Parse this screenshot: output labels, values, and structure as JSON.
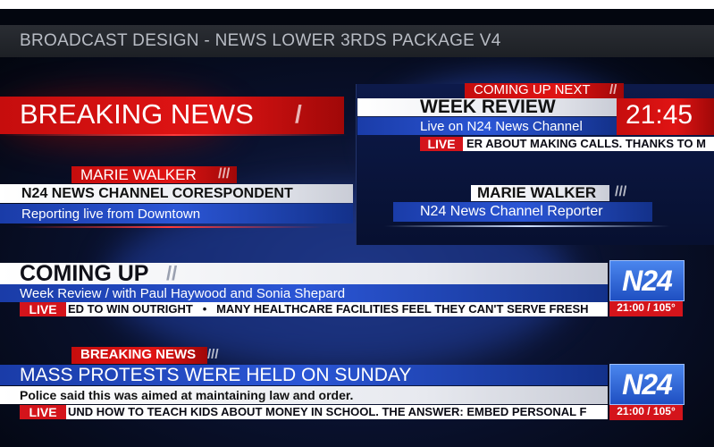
{
  "window_title": "BROADCAST DESIGN - NEWS LOWER 3RDS PACKAGE V4",
  "breaking": {
    "title": "BREAKING NEWS",
    "slash": "/"
  },
  "coming_next": {
    "label": "COMING UP NEXT",
    "slash": "//",
    "title": "WEEK REVIEW",
    "subtitle": "Live on N24 News Channel",
    "time": "21:45",
    "live": "LIVE",
    "ticker": "ER ABOUT MAKING CALLS. THANKS TO M"
  },
  "marie1": {
    "name": "MARIE WALKER",
    "slash": "///",
    "role": "N24 NEWS CHANNEL CORESPONDENT",
    "desc": "Reporting live from Downtown"
  },
  "marie2": {
    "name": "MARIE WALKER",
    "slash": "///",
    "role": "N24 News Channel Reporter"
  },
  "coming_up": {
    "title": "COMING UP",
    "slash": "//",
    "subtitle": "Week Review / with Paul Haywood and Sonia Shepard",
    "live": "LIVE",
    "ticker": "ED TO WIN OUTRIGHT   •   MANY HEALTHCARE FACILITIES FEEL THEY CAN'T SERVE FRESH",
    "logo": "N24",
    "clock": "21:00 / 105°"
  },
  "protests": {
    "label": "BREAKING NEWS",
    "slash": "///",
    "title": "MASS PROTESTS WERE HELD ON SUNDAY",
    "subtitle": "Police said this was aimed at maintaining law and order.",
    "live": "LIVE",
    "ticker": "UND HOW TO TEACH KIDS ABOUT MONEY IN SCHOOL. THE ANSWER: EMBED PERSONAL F",
    "logo": "N24",
    "clock": "21:00 / 105°"
  },
  "colors": {
    "accent_red": "#d4141b",
    "accent_blue": "#2b56d6",
    "background": "#03060f"
  }
}
